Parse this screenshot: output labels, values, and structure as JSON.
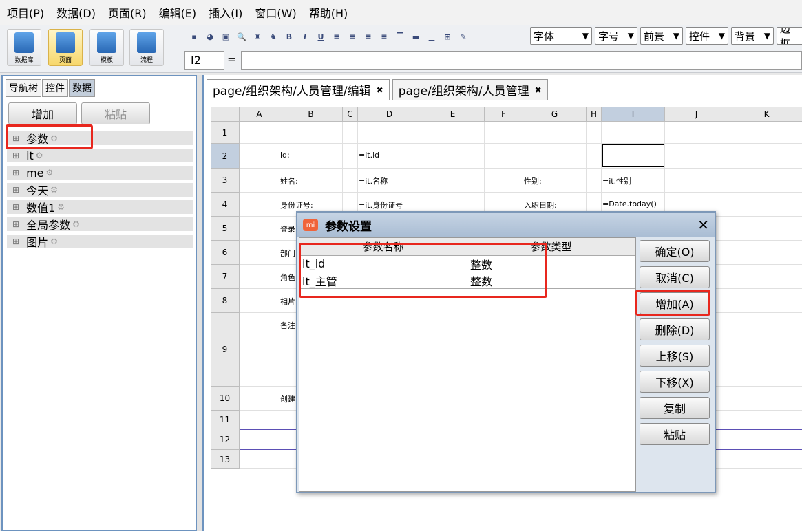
{
  "menu": [
    "项目(P)",
    "数据(D)",
    "页面(R)",
    "编辑(E)",
    "插入(I)",
    "窗口(W)",
    "帮助(H)"
  ],
  "left_toolbar": {
    "buttons": [
      {
        "label": "数据库",
        "active": false
      },
      {
        "label": "页面",
        "active": true
      },
      {
        "label": "模板",
        "active": false
      },
      {
        "label": "流程",
        "active": false
      }
    ]
  },
  "format_toolbar": {
    "icons": [
      "save-icon",
      "globe-icon",
      "image-icon",
      "preview-icon",
      "binoculars-icon",
      "find-icon",
      "bold-icon",
      "italic-icon",
      "underline-icon",
      "align-left-icon",
      "align-center-icon",
      "align-right-icon",
      "justify-icon",
      "valign-top-icon",
      "valign-middle-icon",
      "valign-bottom-icon",
      "merge-icon",
      "format-brush-icon"
    ],
    "icon_glyphs": [
      "▪",
      "◕",
      "▣",
      "🔍",
      "♜",
      "♞",
      "B",
      "I",
      "U",
      "≡",
      "≡",
      "≡",
      "≡",
      "▔",
      "▬",
      "▁",
      "⊞",
      "✎"
    ],
    "font_select": "字体",
    "size_select": "字号",
    "fg_select": "前景",
    "control_select": "控件",
    "bg_select": "背景",
    "border_select": "边框"
  },
  "formula_bar": {
    "cell_ref": "I2",
    "eq": "=",
    "value": ""
  },
  "left_panel": {
    "tabs": [
      "导航树",
      "控件",
      "数据"
    ],
    "active_tab": 2,
    "add_button": "增加",
    "paste_button": "粘贴",
    "tree_items": [
      "参数",
      "it",
      "me",
      "今天",
      "数值1",
      "全局参数",
      "图片"
    ]
  },
  "editor": {
    "tabs": [
      {
        "label": "page/组织架构/人员管理/编辑",
        "active": true
      },
      {
        "label": "page/组织架构/人员管理",
        "active": false
      }
    ],
    "columns": [
      "A",
      "B",
      "C",
      "D",
      "E",
      "F",
      "G",
      "H",
      "I",
      "J",
      "K"
    ],
    "selected_column": "I",
    "rows": [
      "1",
      "2",
      "3",
      "4",
      "5",
      "6",
      "7",
      "8",
      "9",
      "10",
      "11",
      "12",
      "13"
    ],
    "selected_row": "2",
    "cells": {
      "b2": "id:",
      "d2": "=it.id",
      "b3": "姓名:",
      "d3": "=it.名称",
      "g3": "性别:",
      "i3": "=it.性别",
      "b4": "身份证号:",
      "d4": "=it.身份证号",
      "g4": "入职日期:",
      "i4": "=Date.today()",
      "b5": "登录",
      "b6": "部门",
      "b7": "角色",
      "b8": "相片",
      "b9": "备注",
      "b10": "创建"
    }
  },
  "dialog": {
    "title": "参数设置",
    "logo": "mi",
    "close": "✕",
    "headers": [
      "参数名称",
      "参数类型"
    ],
    "rows": [
      {
        "name": "it_id",
        "type": "整数"
      },
      {
        "name": "it_主管",
        "type": "整数"
      }
    ],
    "buttons": [
      "确定(O)",
      "取消(C)",
      "增加(A)",
      "删除(D)",
      "上移(S)",
      "下移(X)",
      "复制",
      "粘贴"
    ]
  },
  "highlight_color": "#e8271e"
}
